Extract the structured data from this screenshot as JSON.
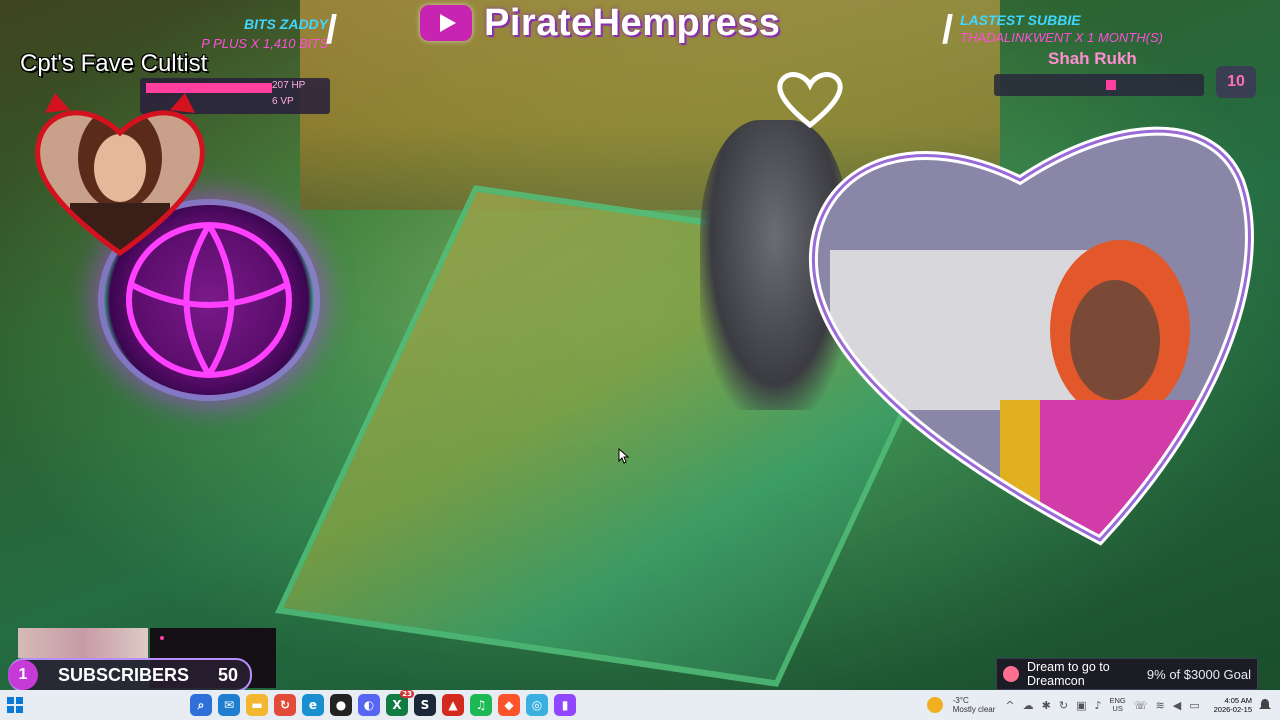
{
  "stream": {
    "channel_name": "PirateHempress",
    "bits_title": "BITS ZADDY",
    "bits_detail": "P     PLUS X 1,410 BITS",
    "sub_title": "LASTEST SUBBIE",
    "sub_detail": "THADALINKWENT X 1 MONTH(S)",
    "sub_name": "Shah Rukh",
    "rank": "10",
    "mod_label": "Cpt's Fave Cultist"
  },
  "game_hud": {
    "hp": "207 HP",
    "vp": "6 VP"
  },
  "subscribers": {
    "count": "1",
    "label": "SUBSCRIBERS",
    "goal": "50"
  },
  "goal_widget": {
    "text": "Dream to go to Dreamcon",
    "progress": "9% of $3000 Goal"
  },
  "taskbar": {
    "weather_temp": "-3°C",
    "weather_desc": "Mostly clear",
    "lang_top": "ENG",
    "lang_bottom": "US",
    "time": "4:05 AM",
    "date": "2026-02-15",
    "badge_count": "23"
  },
  "colors": {
    "accent_pink": "#ff3fa0",
    "accent_cyan": "#3fd6ff",
    "accent_purple": "#c63ad8"
  }
}
